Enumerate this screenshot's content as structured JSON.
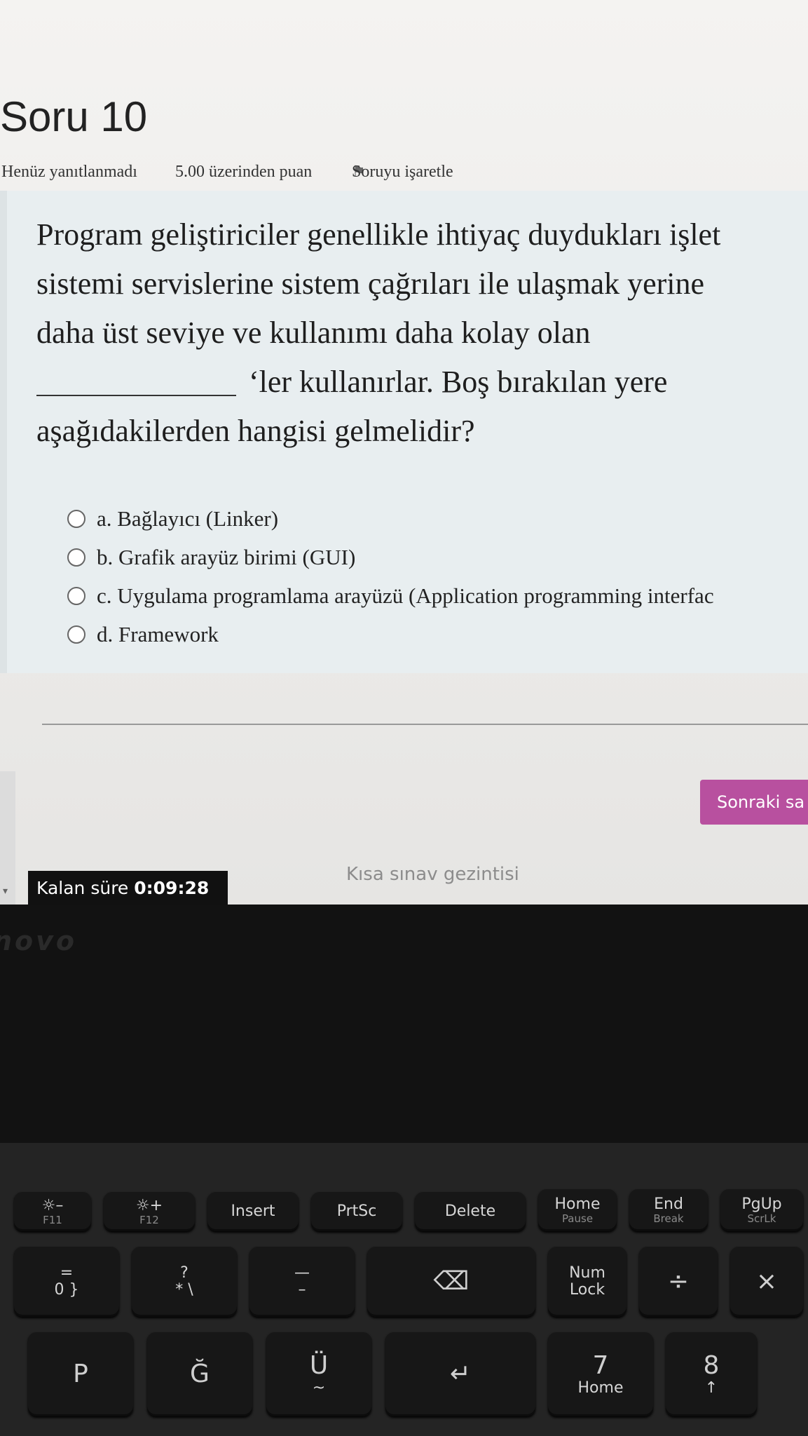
{
  "question": {
    "title": "Soru 10",
    "status": "Henüz yanıtlanmadı",
    "points": "5.00 üzerinden puan",
    "flag_label": "Soruyu işaretle",
    "text_lines": [
      "Program geliştiriciler genellikle ihtiyaç duydukları işlet",
      "sistemi servislerine sistem çağrıları ile ulaşmak yerine",
      "daha üst seviye ve kullanımı daha kolay olan",
      "‘ler kullanırlar. Boş bırakılan yere",
      "aşağıdakilerden hangisi gelmelidir?"
    ],
    "answers": [
      "a. Bağlayıcı (Linker)",
      "b. Grafik arayüz birimi (GUI)",
      "c. Uygulama programlama arayüzü (Application programming interfac",
      "d. Framework"
    ]
  },
  "footer": {
    "next_button": "Sonraki sa",
    "quiz_nav": "Kısa sınav gezintisi",
    "timer_label": "Kalan süre",
    "timer_value": "0:09:28"
  },
  "laptop": {
    "brand": "novo",
    "fn_keys": [
      {
        "main": "☼–",
        "sub": "F11"
      },
      {
        "main": "☼+",
        "sub": "F12"
      },
      {
        "main": "Insert",
        "sub": ""
      },
      {
        "main": "PrtSc",
        "sub": ""
      },
      {
        "main": "Delete",
        "sub": ""
      },
      {
        "main": "Home",
        "sub": "Pause"
      },
      {
        "main": "End",
        "sub": "Break"
      },
      {
        "main": "PgUp",
        "sub": "ScrLk"
      }
    ],
    "row2_keys": [
      {
        "main": "=",
        "sub": "0 }"
      },
      {
        "main": "?",
        "sub": "* \\"
      },
      {
        "main": "—",
        "sub": "–"
      },
      {
        "main": "⌫",
        "sub": ""
      },
      {
        "main": "Num",
        "sub": "Lock"
      },
      {
        "main": "÷",
        "sub": ""
      },
      {
        "main": "×",
        "sub": ""
      }
    ],
    "row3_keys": [
      {
        "main": "P",
        "sub": ""
      },
      {
        "main": "Ğ",
        "sub": ""
      },
      {
        "main": "Ü",
        "sub": "~"
      },
      {
        "main": "↵",
        "sub": ""
      },
      {
        "main": "7",
        "sub": "Home"
      },
      {
        "main": "8",
        "sub": "↑"
      }
    ]
  }
}
